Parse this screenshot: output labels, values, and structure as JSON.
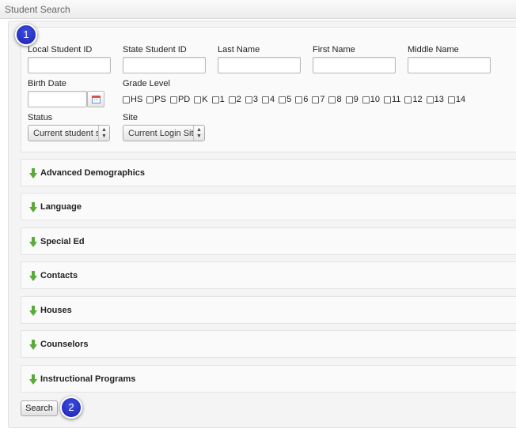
{
  "window": {
    "title": "Student Search"
  },
  "annotations": {
    "badge_1": "1",
    "badge_2": "2"
  },
  "fields": {
    "local_student_id": {
      "label": "Local Student ID",
      "value": ""
    },
    "state_student_id": {
      "label": "State Student ID",
      "value": ""
    },
    "last_name": {
      "label": "Last Name",
      "value": ""
    },
    "first_name": {
      "label": "First Name",
      "value": ""
    },
    "middle_name": {
      "label": "Middle Name",
      "value": ""
    },
    "birth_date": {
      "label": "Birth Date",
      "value": ""
    },
    "grade_level": {
      "label": "Grade Level"
    },
    "status": {
      "label": "Status",
      "value": "Current student s"
    },
    "site": {
      "label": "Site",
      "value": "Current Login Site"
    }
  },
  "grades": [
    {
      "label": "HS",
      "checked": false
    },
    {
      "label": "PS",
      "checked": false
    },
    {
      "label": "PD",
      "checked": false
    },
    {
      "label": "K",
      "checked": false
    },
    {
      "label": "1",
      "checked": false
    },
    {
      "label": "2",
      "checked": false
    },
    {
      "label": "3",
      "checked": false
    },
    {
      "label": "4",
      "checked": false
    },
    {
      "label": "5",
      "checked": false
    },
    {
      "label": "6",
      "checked": false
    },
    {
      "label": "7",
      "checked": false
    },
    {
      "label": "8",
      "checked": false
    },
    {
      "label": "9",
      "checked": false
    },
    {
      "label": "10",
      "checked": false
    },
    {
      "label": "11",
      "checked": false
    },
    {
      "label": "12",
      "checked": false
    },
    {
      "label": "13",
      "checked": false
    },
    {
      "label": "14",
      "checked": false
    }
  ],
  "sections": [
    {
      "title": "Advanced Demographics"
    },
    {
      "title": "Language"
    },
    {
      "title": "Special Ed"
    },
    {
      "title": "Contacts"
    },
    {
      "title": "Houses"
    },
    {
      "title": "Counselors"
    },
    {
      "title": "Instructional Programs"
    }
  ],
  "actions": {
    "search_label": "Search"
  },
  "colors": {
    "expand_arrow": "#5aaa3c",
    "badge": "#2430c8",
    "panel_bg": "#fafafa"
  },
  "icons": {
    "calendar": "calendar-icon",
    "expand": "expand-arrow-icon"
  }
}
